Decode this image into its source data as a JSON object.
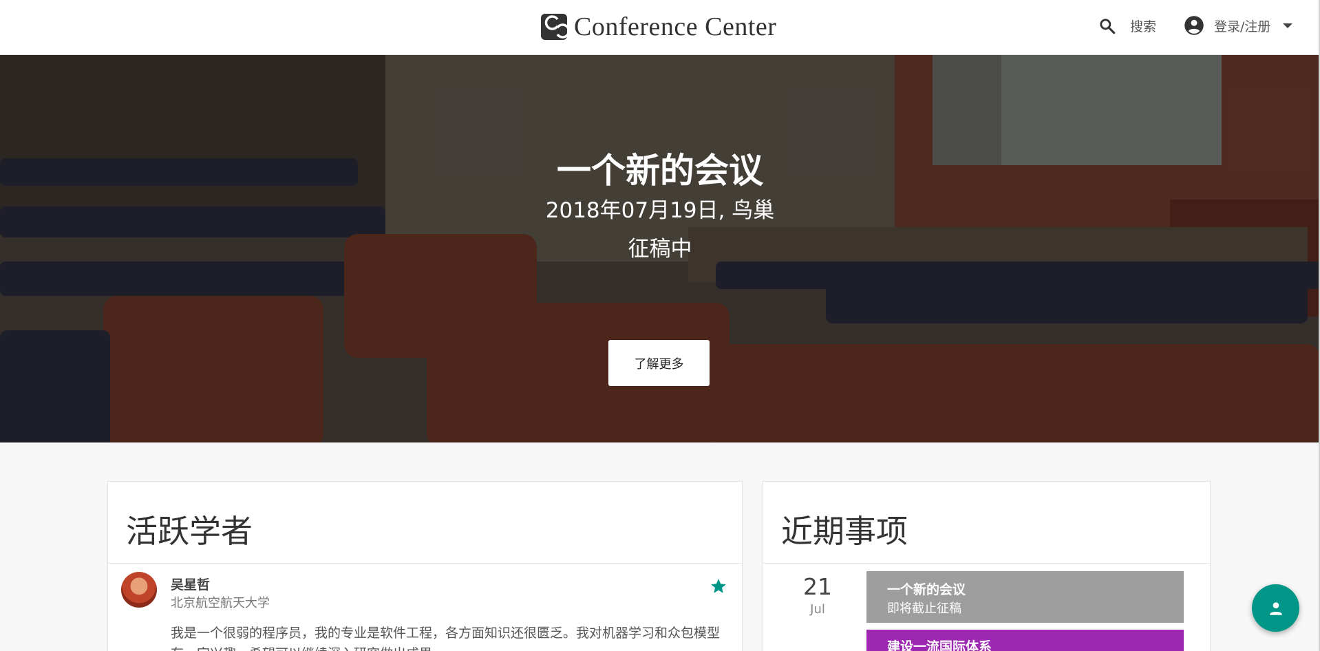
{
  "header": {
    "brand": "Conference Center",
    "search_label": "搜索",
    "login_label": "登录/注册"
  },
  "hero": {
    "title": "一个新的会议",
    "subtitle": "2018年07月19日, 鸟巢",
    "status": "征稿中",
    "button_label": "了解更多"
  },
  "scholars": {
    "title": "活跃学者",
    "items": [
      {
        "name": "吴星哲",
        "affiliation": "北京航空航天大学",
        "bio": "我是一个很弱的程序员，我的专业是软件工程，各方面知识还很匮乏。我对机器学习和众包模型有一定兴趣，希望可以继续深入研究做出成果。",
        "starred": true
      }
    ]
  },
  "events": {
    "title": "近期事项",
    "items": [
      {
        "day": "21",
        "month": "Jul",
        "title": "一个新的会议",
        "status": "即将截止征稿",
        "color": "#9e9e9e"
      },
      {
        "title": "建设一流国际体系",
        "color": "#9c27b0"
      }
    ]
  },
  "colors": {
    "accent": "#009688",
    "event_grey": "#9e9e9e",
    "event_purple": "#9c27b0"
  },
  "icons": [
    "logo-icon",
    "search-icon",
    "account-circle-icon",
    "caret-down-icon",
    "star-icon",
    "person-icon"
  ]
}
